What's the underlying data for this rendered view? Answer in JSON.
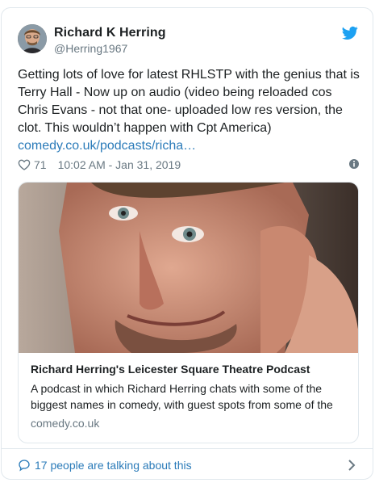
{
  "author": {
    "name": "Richard K Herring",
    "handle": "@Herring1967"
  },
  "tweet": {
    "text": "Getting lots of love for  latest RHLSTP with the genius that is Terry Hall - Now up on audio (video being reloaded cos Chris Evans - not that one- uploaded low res version, the clot. This wouldn’t happen with Cpt America)",
    "link": "comedy.co.uk/podcasts/richa…",
    "likes": "71",
    "timestamp": "10:02 AM - Jan 31, 2019"
  },
  "card": {
    "title": "Richard Herring's Leicester Square Theatre Podcast",
    "description": "A podcast in which Richard Herring chats with some of the biggest names in comedy, with guest spots from some of the",
    "domain": "comedy.co.uk"
  },
  "footer": {
    "talking": "17 people are talking about this"
  },
  "colors": {
    "link": "#2b7bb9",
    "twitter_blue": "#1da1f2",
    "muted": "#697882",
    "border": "#e1e8ed"
  },
  "icons": {
    "brand": "twitter-bird-icon",
    "like": "heart-icon",
    "info": "info-icon",
    "reply": "speech-bubble-icon",
    "more": "chevron-right-icon"
  }
}
